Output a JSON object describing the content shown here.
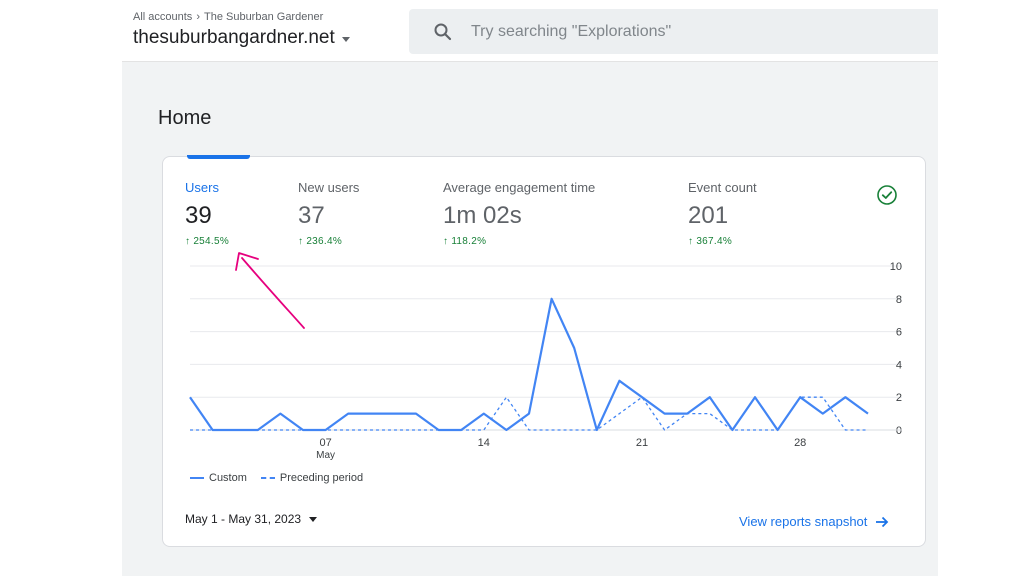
{
  "breadcrumb": {
    "root": "All accounts",
    "account": "The Suburban Gardener"
  },
  "property": {
    "name": "thesuburbangardner.net"
  },
  "search": {
    "placeholder": "Try searching \"Explorations\""
  },
  "page": {
    "title": "Home"
  },
  "metrics": [
    {
      "label": "Users",
      "value": "39",
      "change": "254.5%"
    },
    {
      "label": "New users",
      "value": "37",
      "change": "236.4%"
    },
    {
      "label": "Average engagement time",
      "value": "1m 02s",
      "change": "118.2%"
    },
    {
      "label": "Event count",
      "value": "201",
      "change": "367.4%"
    }
  ],
  "legend": {
    "current": "Custom",
    "previous": "Preceding period"
  },
  "footer": {
    "date_range": "May 1 - May 31, 2023",
    "snapshot_link": "View reports snapshot"
  },
  "colors": {
    "accent": "#1a73e8",
    "series": "#4285f4",
    "positive": "#188038",
    "annotation": "#e6007e"
  },
  "chart_data": {
    "type": "line",
    "x": [
      1,
      2,
      3,
      4,
      5,
      6,
      7,
      8,
      9,
      10,
      11,
      12,
      13,
      14,
      15,
      16,
      17,
      18,
      19,
      20,
      21,
      22,
      23,
      24,
      25,
      26,
      27,
      28,
      29,
      30,
      31
    ],
    "x_ticks": [
      {
        "day": 7,
        "label": "07",
        "sub": "May"
      },
      {
        "day": 14,
        "label": "14"
      },
      {
        "day": 21,
        "label": "21"
      },
      {
        "day": 28,
        "label": "28"
      }
    ],
    "y_ticks": [
      0,
      2,
      4,
      6,
      8,
      10
    ],
    "ylim": [
      0,
      10
    ],
    "grid": true,
    "series": [
      {
        "name": "Custom",
        "style": "solid",
        "values": [
          2,
          0,
          0,
          0,
          1,
          0,
          0,
          1,
          1,
          1,
          1,
          0,
          0,
          1,
          0,
          1,
          8,
          5,
          0,
          3,
          2,
          1,
          1,
          2,
          0,
          2,
          0,
          2,
          1,
          2,
          1
        ]
      },
      {
        "name": "Preceding period",
        "style": "dashed",
        "values": [
          0,
          0,
          0,
          0,
          0,
          0,
          0,
          0,
          0,
          0,
          0,
          0,
          0,
          0,
          2,
          0,
          0,
          0,
          0,
          1,
          2,
          0,
          1,
          1,
          0,
          0,
          0,
          2,
          2,
          0,
          0
        ]
      }
    ]
  }
}
